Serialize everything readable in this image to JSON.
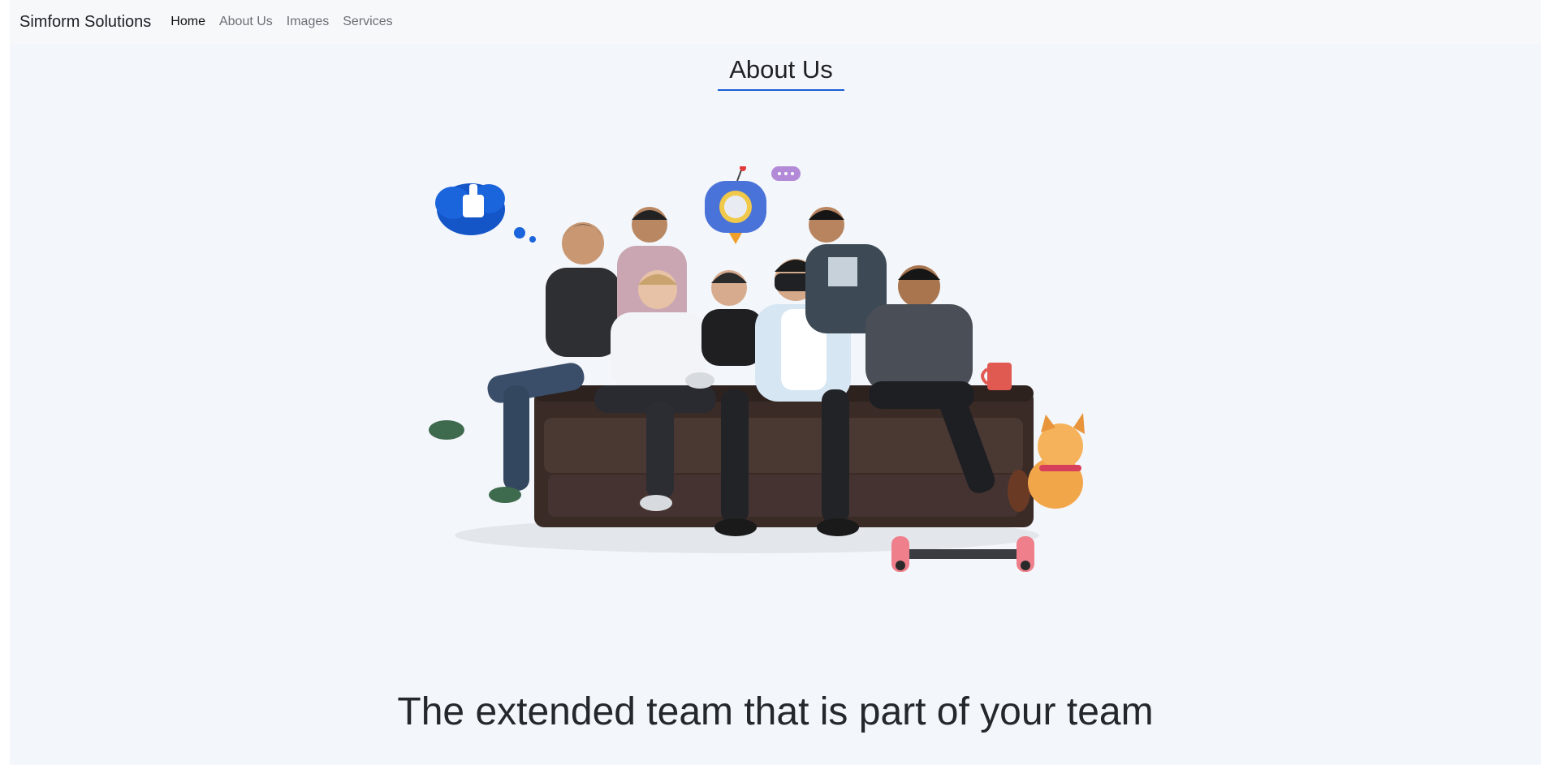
{
  "navbar": {
    "brand": "Simform Solutions",
    "links": [
      {
        "label": "Home",
        "active": true
      },
      {
        "label": "About Us",
        "active": false
      },
      {
        "label": "Images",
        "active": false
      },
      {
        "label": "Services",
        "active": false
      }
    ]
  },
  "about": {
    "title": "About Us",
    "tagline": "The extended team that is part of your team"
  },
  "colors": {
    "accent_underline": "#1a5fd4",
    "page_background": "#f3f6fa",
    "navbar_background": "#f7f8fa"
  }
}
